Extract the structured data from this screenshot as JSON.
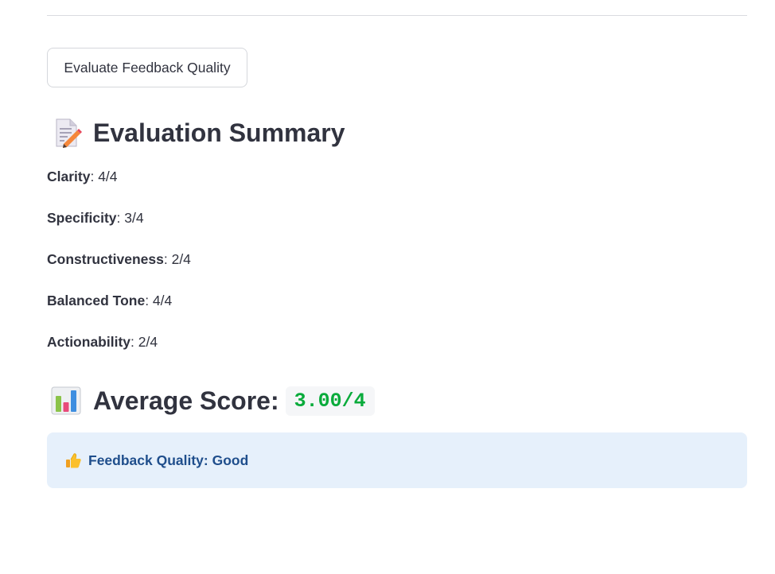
{
  "button": {
    "label": "Evaluate Feedback Quality"
  },
  "summary": {
    "icon": "memo-icon",
    "title": "Evaluation Summary",
    "metrics": [
      {
        "name": "Clarity",
        "value": ": 4/4"
      },
      {
        "name": "Specificity",
        "value": ": 3/4"
      },
      {
        "name": "Constructiveness",
        "value": ": 2/4"
      },
      {
        "name": "Balanced Tone",
        "value": ": 4/4"
      },
      {
        "name": "Actionability",
        "value": ": 2/4"
      }
    ]
  },
  "average": {
    "icon": "bar-chart-icon",
    "label": "Average Score:",
    "score": "3.00/4",
    "score_color": "#09ab3b"
  },
  "quality": {
    "icon": "thumbs-up-icon",
    "text": "Feedback Quality: Good",
    "bg_color": "#e6f0fb",
    "text_color": "#1f4e8c"
  }
}
